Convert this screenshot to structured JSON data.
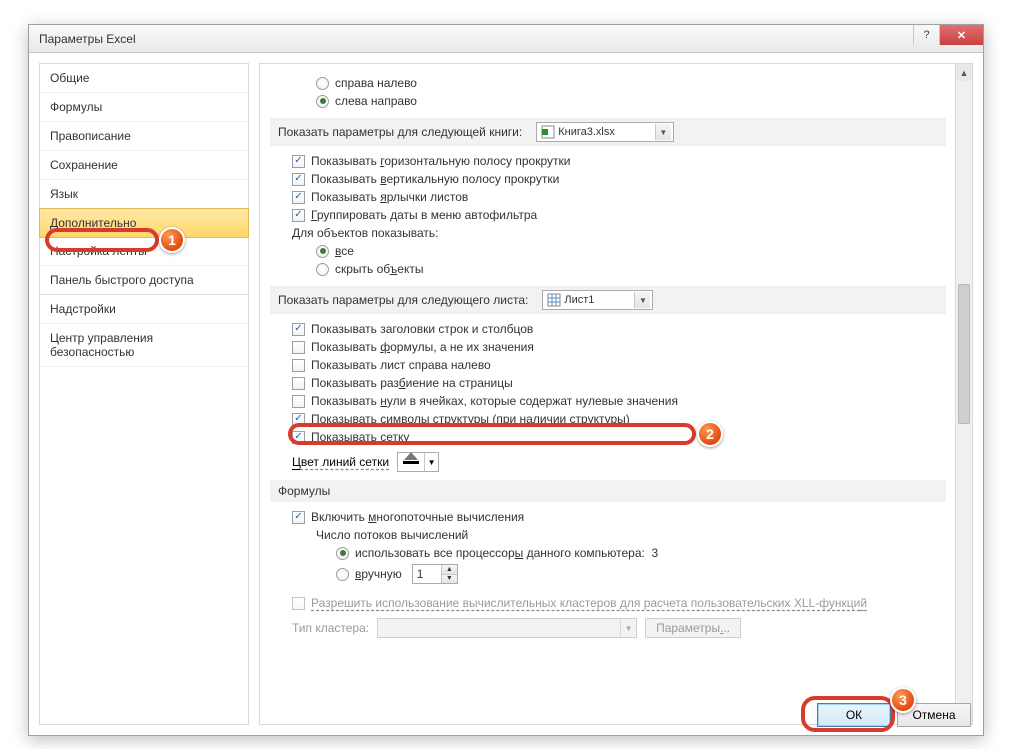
{
  "window": {
    "title": "Параметры Excel"
  },
  "sidebar": {
    "items": [
      {
        "label": "Общие"
      },
      {
        "label": "Формулы"
      },
      {
        "label": "Правописание"
      },
      {
        "label": "Сохранение"
      },
      {
        "label": "Язык"
      },
      {
        "label": "Дополнительно"
      },
      {
        "label": "Настройка ленты"
      },
      {
        "label": "Панель быстрого доступа"
      },
      {
        "label": "Надстройки"
      },
      {
        "label": "Центр управления безопасностью"
      }
    ],
    "selected_index": 5
  },
  "content": {
    "dir_rtl": "справа налево",
    "dir_ltr": "слева направо",
    "book_section_label": "Показать параметры для следующей книги:",
    "book_name": "Книга3.xlsx",
    "book_opts": {
      "hscroll": "Показывать горизонтальную полосу прокрутки",
      "vscroll": "Показывать вертикальную полосу прокрутки",
      "tabs": "Показывать ярлычки листов",
      "group_dates": "Группировать даты в меню автофильтра"
    },
    "objects_label": "Для объектов показывать:",
    "obj_all": "все",
    "obj_hide": "скрыть объекты",
    "sheet_section_label": "Показать параметры для следующего листа:",
    "sheet_name": "Лист1",
    "sheet_opts": {
      "headers": "Показывать заголовки строк и столбцов",
      "formulas": "Показывать формулы, а не их значения",
      "rtl_sheet": "Показывать лист справа налево",
      "breaks": "Показывать разбиение на страницы",
      "zeros": "Показывать нули в ячейках, которые содержат нулевые значения",
      "outline": "Показывать символы структуры (при наличии структуры)",
      "grid": "Показывать сетку"
    },
    "grid_color_label": "Цвет линий сетки",
    "formulas_header": "Формулы",
    "multithread": "Включить многопоточные вычисления",
    "threads_label": "Число потоков вычислений",
    "use_all_cpu": "использовать все процессоры данного компьютера:",
    "cpu_count": "3",
    "manual": "вручную",
    "manual_value": "1",
    "clusters": "Разрешить использование вычислительных кластеров для расчета пользовательских XLL-функций",
    "cluster_type_label": "Тип кластера:",
    "params_btn": "Параметры..."
  },
  "footer": {
    "ok": "ОК",
    "cancel": "Отмена"
  },
  "badges": {
    "b1": "1",
    "b2": "2",
    "b3": "3"
  }
}
